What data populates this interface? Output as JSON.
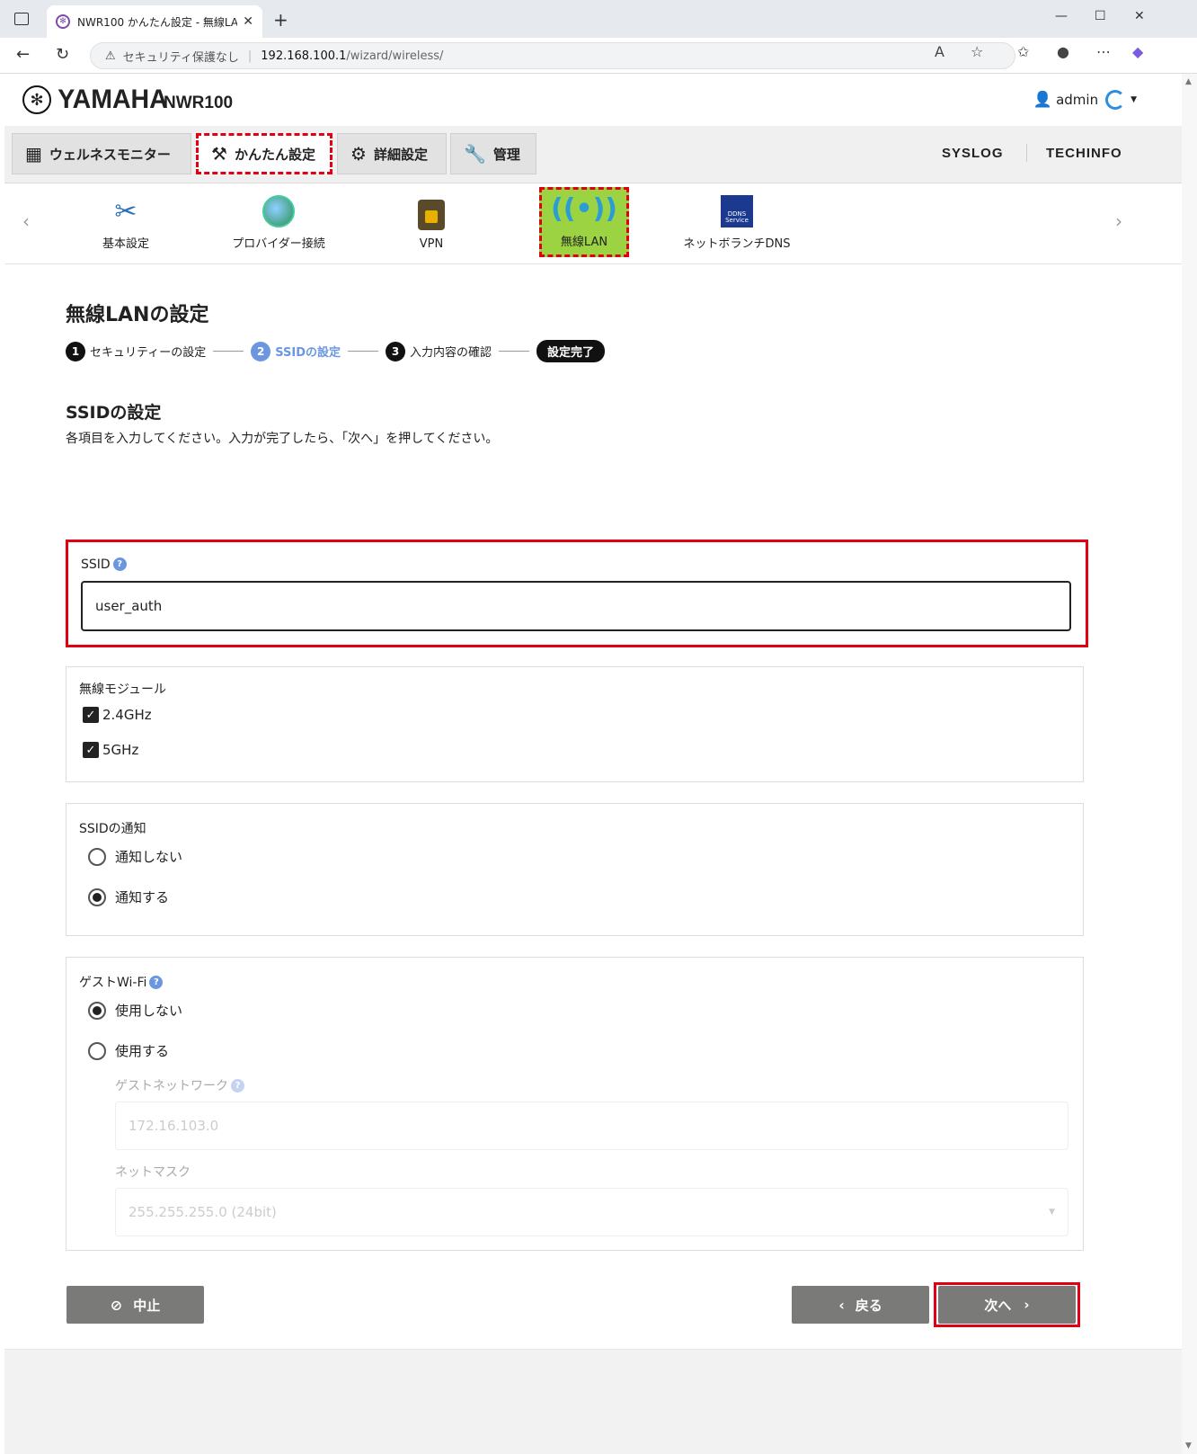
{
  "browser": {
    "tab_title": "NWR100 かんたん設定 - 無線LAN",
    "security_text": "セキュリティ保護なし",
    "url_host": "192.168.100.1",
    "url_path": "/wizard/wireless/"
  },
  "header": {
    "brand": "YAMAHA",
    "model": "NWR100",
    "user": "admin"
  },
  "mainnav": {
    "tabs": [
      {
        "label": "ウェルネスモニター",
        "icon": "dashboard-icon"
      },
      {
        "label": "かんたん設定",
        "icon": "magic-wand-icon"
      },
      {
        "label": "詳細設定",
        "icon": "gear-icon"
      },
      {
        "label": "管理",
        "icon": "wrench-icon"
      }
    ],
    "links": [
      "SYSLOG",
      "TECHINFO"
    ]
  },
  "subnav": {
    "items": [
      {
        "label": "基本設定",
        "icon": "tools-icon"
      },
      {
        "label": "プロバイダー接続",
        "icon": "globe-icon"
      },
      {
        "label": "VPN",
        "icon": "vpn-lock-icon"
      },
      {
        "label": "無線LAN",
        "icon": "wifi-icon"
      },
      {
        "label": "ネットボランチDNS",
        "icon": "dns-service-icon"
      }
    ],
    "dns_icon_text": "DDNS Service"
  },
  "page": {
    "title": "無線LANの設定",
    "steps": [
      {
        "num": "1",
        "label": "セキュリティーの設定"
      },
      {
        "num": "2",
        "label": "SSIDの設定"
      },
      {
        "num": "3",
        "label": "入力内容の確認"
      }
    ],
    "step_final": "設定完了",
    "section_title": "SSIDの設定",
    "description": "各項目を入力してください。入力が完了したら、「次へ」を押してください。"
  },
  "form": {
    "ssid_label": "SSID",
    "ssid_value": "user_auth",
    "module_label": "無線モジュール",
    "module_options": [
      "2.4GHz",
      "5GHz"
    ],
    "broadcast_label": "SSIDの通知",
    "broadcast_options": [
      "通知しない",
      "通知する"
    ],
    "guest_label": "ゲストWi-Fi",
    "guest_options": [
      "使用しない",
      "使用する"
    ],
    "guest_network_label": "ゲストネットワーク",
    "guest_network_value": "172.16.103.0",
    "netmask_label": "ネットマスク",
    "netmask_value": "255.255.255.0 (24bit)"
  },
  "buttons": {
    "cancel": "中止",
    "back": "戻る",
    "next": "次へ"
  },
  "colors": {
    "highlight": "#e00012",
    "active_sub": "#9bd343",
    "button": "#7a7a78",
    "step_current": "#6b97e0"
  }
}
